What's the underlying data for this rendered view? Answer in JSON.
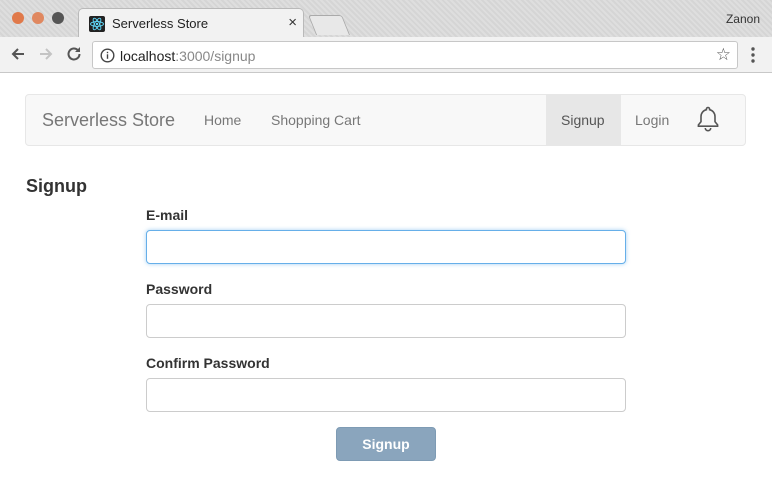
{
  "browser": {
    "tab_title": "Serverless Store",
    "tab_close": "×",
    "profile_name": "Zanon",
    "url_host": "localhost",
    "url_rest": ":3000/signup",
    "star": "☆"
  },
  "navbar": {
    "brand": "Serverless Store",
    "links": {
      "home": "Home",
      "cart": "Shopping Cart",
      "signup": "Signup",
      "login": "Login"
    },
    "active_link": "signup",
    "notification_icon": "bell-icon"
  },
  "form": {
    "title": "Signup",
    "email_label": "E-mail",
    "email_value": "",
    "password_label": "Password",
    "password_value": "",
    "confirm_label": "Confirm Password",
    "confirm_value": "",
    "submit_label": "Signup"
  },
  "colors": {
    "submit_bg": "#8aa5bd",
    "focus_border": "#66afe9",
    "traffic_light": "#e0794a"
  }
}
